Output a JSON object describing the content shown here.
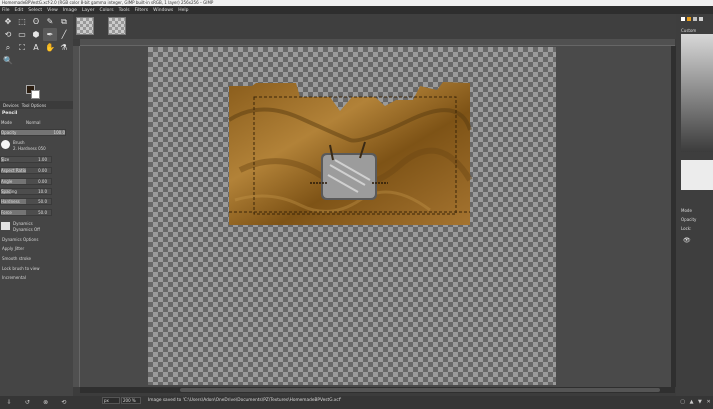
{
  "window": {
    "title": "HomemadeBPVestG.xcf-2.0 (RGB color 8-bit gamma integer, GIMP built-in sRGB, 1 layer) 256x256 – GIMP"
  },
  "menu": [
    "File",
    "Edit",
    "Select",
    "View",
    "Image",
    "Layer",
    "Colors",
    "Tools",
    "Filters",
    "Windows",
    "Help"
  ],
  "tools": [
    "✥",
    "⬚",
    "ʘ",
    "✎",
    "⧉",
    "⟲",
    "▭",
    "⬢",
    "✒",
    "╱",
    "⌕",
    "⛶",
    "A",
    "✋",
    "⚗",
    "🔍"
  ],
  "panel": {
    "tabs": [
      "Devices",
      "Tool Options"
    ],
    "title": "Pencil",
    "mode_label": "Mode",
    "mode_value": "Normal",
    "opacity_label": "Opacity",
    "opacity_value": "100.0",
    "brush_label": "Brush",
    "brush_value": "2. Hardness 050",
    "size_label": "Size",
    "size_value": "1.00",
    "aspect_label": "Aspect Ratio",
    "aspect_value": "0.00",
    "angle_label": "Angle",
    "angle_value": "0.00",
    "spacing_label": "Spacing",
    "spacing_value": "10.0",
    "hardness_label": "Hardness",
    "hardness_value": "50.0",
    "force_label": "Force",
    "force_value": "50.0",
    "dynamics_label": "Dynamics",
    "dynamics_value": "Dynamics Off",
    "checks": [
      "Dynamics Options",
      "Apply Jitter",
      "Smooth stroke",
      "Lock brush to view",
      "Incremental"
    ]
  },
  "right_dock": {
    "custom_label": "Custom",
    "mode_label": "Mode",
    "opacity_label": "Opacity",
    "lock_label": "Lock:"
  },
  "status": {
    "unit": "px",
    "zoom": "200 %",
    "message": "Image saved to 'C:\\Users\\Adon\\OneDrive\\Documents\\PZ\\Textures\\HomemadeBPVestG.xcf'"
  }
}
